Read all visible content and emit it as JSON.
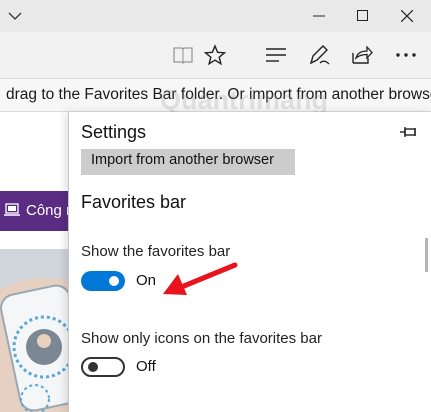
{
  "titlebar": {
    "controls": [
      "minimize-icon",
      "maximize-icon",
      "close-icon"
    ]
  },
  "toolbar": {
    "icons": [
      "reading-view-icon",
      "favorite-star-icon",
      "hub-icon",
      "web-note-icon",
      "share-icon",
      "more-icon"
    ]
  },
  "infobar": {
    "text": "drag to the Favorites Bar folder. Or import from another browser"
  },
  "background": {
    "button_label": "Công n"
  },
  "watermark": {
    "text": "Quantrimang"
  },
  "settings": {
    "title": "Settings",
    "import_button": "Import from another browser",
    "section_title": "Favorites bar",
    "show_favorites_bar": {
      "label": "Show the favorites bar",
      "state": "On",
      "value": true
    },
    "show_only_icons": {
      "label": "Show only icons on the favorites bar",
      "state": "Off",
      "value": false
    }
  },
  "colors": {
    "accent": "#0078d7",
    "purple": "#5b2c83",
    "arrow": "#e8131c"
  }
}
